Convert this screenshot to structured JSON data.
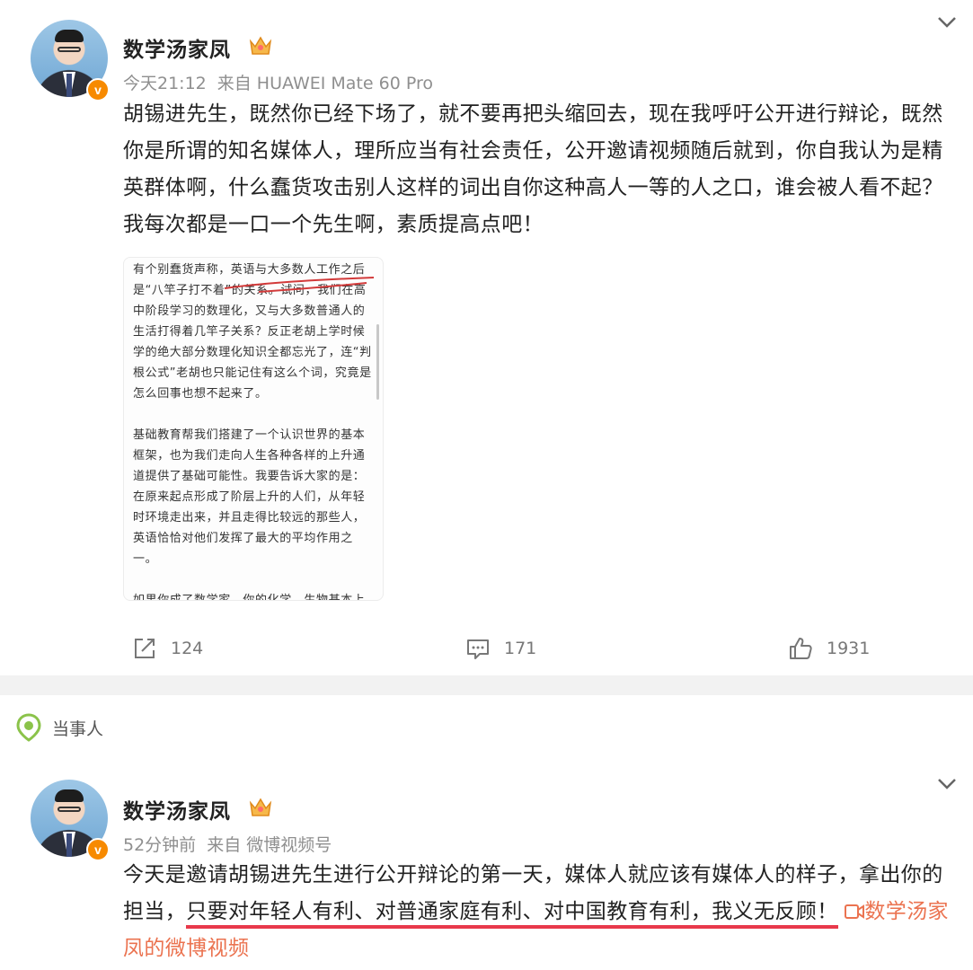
{
  "post1": {
    "author": "数学汤家凤",
    "time": "今天21:12",
    "source": "来自 HUAWEI Mate 60 Pro",
    "text": "胡锡进先生，既然你已经下场了，就不要再把头缩回去，现在我呼吁公开进行辩论，既然你是所谓的知名媒体人，理所应当有社会责任，公开邀请视频随后就到，你自我认为是精英群体啊，什么蠢货攻击别人这样的词出自你这种高人一等的人之口，谁会被人看不起？我每次都是一口一个先生啊，素质提高点吧！",
    "image_paragraphs": [
      "有个别蠢货声称，英语与大多数人工作之后是“八竿子打不着”的关系。试问，我们在高中阶段学习的数理化，又与大多数普通人的生活打得着几竿子关系？反正老胡上学时候学的绝大部分数理化知识全都忘光了，连“判根公式”老胡也只能记住有这么个词，究竟是怎么回事也想不起来了。",
      "基础教育帮我们搭建了一个认识世界的基本框架，也为我们走向人生各种各样的上升通道提供了基础可能性。我要告诉大家的是：在原来起点形成了阶层上升的人们，从年轻时环境走出来，并且走得比较远的那些人，英语恰恰对他们发挥了最大的平均作用之一。",
      "如果你成了数学家，你的化学、生物基本上自学了；如果你成了一流化学家，数学会用得不"
    ],
    "actions": {
      "repost": "124",
      "comment": "171",
      "like": "1931"
    }
  },
  "party_label": "当事人",
  "post2": {
    "author": "数学汤家凤",
    "time": "52分钟前",
    "source": "来自 微博视频号",
    "text_plain": "今天是邀请胡锡进先生进行公开辩论的第一天，媒体人就应该有媒体人的样子，拿出你的担当，",
    "text_underlined": "只要对年轻人有利、对普通家庭有利、对中国教育有利，我义无反顾！",
    "link": "数学汤家凤的微博视频"
  },
  "colors": {
    "badge": "#f78a00",
    "underline": "#e8394b",
    "link": "#eb7350",
    "party_icon": "#8bc34a"
  }
}
